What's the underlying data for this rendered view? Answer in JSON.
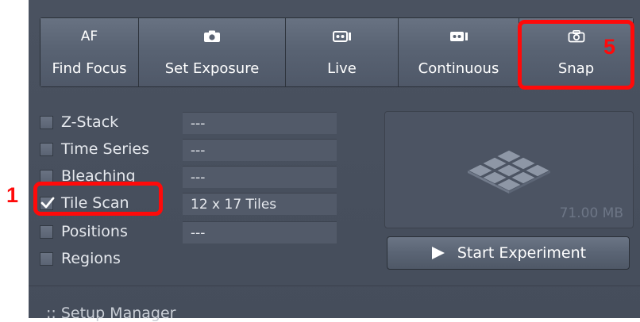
{
  "toolbar": {
    "af": {
      "top": "AF",
      "label": "Find Focus"
    },
    "set_exposure": {
      "label": "Set Exposure"
    },
    "live": {
      "label": "Live"
    },
    "continuous": {
      "label": "Continuous"
    },
    "snap": {
      "label": "Snap"
    }
  },
  "experiments": [
    {
      "label": "Z-Stack",
      "value": "---",
      "checked": false
    },
    {
      "label": "Time Series",
      "value": "---",
      "checked": false
    },
    {
      "label": "Bleaching",
      "value": "---",
      "checked": false
    },
    {
      "label": "Tile Scan",
      "value": "12 x 17 Tiles",
      "checked": true
    },
    {
      "label": "Positions",
      "value": "---",
      "checked": false
    },
    {
      "label": "Regions",
      "checked": false
    }
  ],
  "preview": {
    "size": "71.00 MB"
  },
  "start_button": {
    "label": "Start Experiment"
  },
  "setup_manager": {
    "label": ":: Setup Manager"
  },
  "annotations": {
    "one": "1",
    "five": "5",
    "color": "#ff0a0a"
  },
  "icons": {
    "set_exposure": "camera-icon",
    "live": "video-icon",
    "continuous": "video-icon",
    "snap": "camera-outline-icon",
    "start": "play-icon",
    "preview": "tile-grid-icon"
  }
}
